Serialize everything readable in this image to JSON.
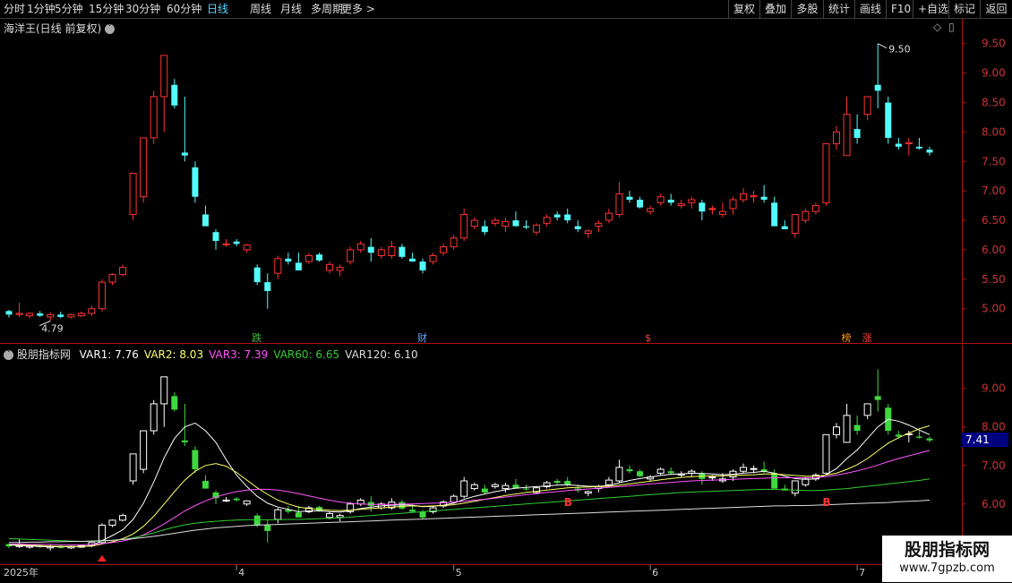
{
  "toolbar": {
    "periods": [
      "分时",
      "1分钟",
      "5分钟",
      "15分钟",
      "30分钟",
      "60分钟",
      "日线",
      "周线",
      "月线",
      "多周期",
      "更多 >"
    ],
    "active_period": "日线",
    "right_buttons": [
      "复权",
      "叠加",
      "多股",
      "统计",
      "画线",
      "F10",
      "+自选",
      "标记",
      "返回"
    ]
  },
  "main": {
    "title": "海洋王(日线 前复权)",
    "high_label": "9.50",
    "low_label": "4.79",
    "y_ticks": [
      "9.50",
      "9.00",
      "8.50",
      "8.00",
      "7.50",
      "7.00",
      "6.50",
      "6.00",
      "5.50",
      "5.00"
    ],
    "event_markers": [
      {
        "text": "跌",
        "color": "#3ec43e"
      },
      {
        "text": "财",
        "color": "#5fa8ff"
      },
      {
        "text": "$",
        "color": "#ff4040"
      },
      {
        "text": "榜",
        "color": "#ff9900"
      },
      {
        "text": "涨",
        "color": "#ff4040"
      }
    ]
  },
  "indicator": {
    "name": "股朋指标网",
    "vars": [
      {
        "label": "VAR1: 7.76",
        "color": "#ffffff"
      },
      {
        "label": "VAR2: 8.03",
        "color": "#ffff66"
      },
      {
        "label": "VAR3: 7.39",
        "color": "#ff55ff"
      },
      {
        "label": "VAR60: 6.65",
        "color": "#33cc33"
      },
      {
        "label": "VAR120: 6.10",
        "color": "#dddddd"
      }
    ],
    "y_ticks": [
      "9.00",
      "8.00",
      "7.00",
      "6.00"
    ],
    "current_price": "7.41",
    "signals": [
      "B",
      "B"
    ]
  },
  "time_axis": {
    "labels": [
      "2025年",
      "4",
      "5",
      "6",
      "7"
    ]
  },
  "watermark": {
    "line1": "股朋指标网",
    "line2": "www.7gpzb.com"
  },
  "colors": {
    "up": "#ff3333",
    "down": "#54fcfc",
    "bg": "#000000",
    "axis": "#b01010",
    "active": "#5fd3ff"
  },
  "chart_data": {
    "type": "candlestick",
    "ylim": [
      4.6,
      9.8
    ],
    "y_ticks": [
      9.5,
      9.0,
      8.5,
      8.0,
      7.5,
      7.0,
      6.5,
      6.0,
      5.5,
      5.0
    ],
    "ohlc": [
      [
        4.96,
        4.98,
        4.85,
        4.9
      ],
      [
        4.9,
        5.1,
        4.86,
        4.92
      ],
      [
        4.88,
        4.94,
        4.84,
        4.92
      ],
      [
        4.92,
        4.96,
        4.86,
        4.88
      ],
      [
        4.86,
        4.94,
        4.79,
        4.9
      ],
      [
        4.9,
        4.95,
        4.84,
        4.86
      ],
      [
        4.86,
        4.92,
        4.83,
        4.9
      ],
      [
        4.88,
        4.95,
        4.86,
        4.92
      ],
      [
        4.92,
        5.05,
        4.88,
        5.0
      ],
      [
        5.0,
        5.5,
        4.95,
        5.45
      ],
      [
        5.45,
        5.6,
        5.4,
        5.58
      ],
      [
        5.58,
        5.75,
        5.55,
        5.7
      ],
      [
        6.6,
        7.3,
        6.5,
        7.3
      ],
      [
        6.9,
        7.9,
        6.8,
        7.9
      ],
      [
        7.9,
        8.7,
        7.8,
        8.6
      ],
      [
        8.6,
        9.3,
        8.0,
        9.3
      ],
      [
        8.8,
        8.9,
        8.4,
        8.45
      ],
      [
        7.65,
        8.6,
        7.5,
        7.6
      ],
      [
        7.4,
        7.5,
        6.8,
        6.9
      ],
      [
        6.6,
        6.75,
        6.4,
        6.4
      ],
      [
        6.3,
        6.35,
        6.0,
        6.15
      ],
      [
        6.1,
        6.18,
        6.05,
        6.1
      ],
      [
        6.14,
        6.18,
        6.06,
        6.1
      ],
      [
        6.0,
        6.1,
        5.95,
        6.08
      ],
      [
        5.7,
        5.75,
        5.4,
        5.45
      ],
      [
        5.45,
        5.6,
        5.0,
        5.3
      ],
      [
        5.6,
        5.9,
        5.5,
        5.85
      ],
      [
        5.85,
        5.95,
        5.75,
        5.8
      ],
      [
        5.78,
        5.95,
        5.7,
        5.65
      ],
      [
        5.8,
        5.95,
        5.76,
        5.9
      ],
      [
        5.92,
        5.95,
        5.8,
        5.82
      ],
      [
        5.65,
        5.8,
        5.6,
        5.75
      ],
      [
        5.65,
        5.75,
        5.55,
        5.7
      ],
      [
        5.8,
        6.05,
        5.75,
        6.0
      ],
      [
        6.0,
        6.15,
        5.95,
        6.1
      ],
      [
        6.05,
        6.2,
        5.8,
        5.95
      ],
      [
        5.9,
        6.05,
        5.85,
        6.0
      ],
      [
        5.9,
        6.15,
        5.85,
        6.05
      ],
      [
        6.05,
        6.1,
        5.85,
        5.88
      ],
      [
        5.85,
        5.95,
        5.8,
        5.8
      ],
      [
        5.8,
        5.85,
        5.6,
        5.65
      ],
      [
        5.8,
        5.95,
        5.75,
        5.9
      ],
      [
        5.95,
        6.1,
        5.9,
        6.05
      ],
      [
        6.05,
        6.25,
        6.0,
        6.2
      ],
      [
        6.2,
        6.7,
        6.15,
        6.6
      ],
      [
        6.4,
        6.55,
        6.35,
        6.5
      ],
      [
        6.4,
        6.5,
        6.25,
        6.3
      ],
      [
        6.45,
        6.55,
        6.4,
        6.5
      ],
      [
        6.4,
        6.55,
        6.3,
        6.48
      ],
      [
        6.5,
        6.65,
        6.45,
        6.4
      ],
      [
        6.4,
        6.5,
        6.35,
        6.38
      ],
      [
        6.3,
        6.45,
        6.25,
        6.42
      ],
      [
        6.45,
        6.6,
        6.4,
        6.55
      ],
      [
        6.6,
        6.65,
        6.5,
        6.55
      ],
      [
        6.6,
        6.7,
        6.45,
        6.5
      ],
      [
        6.4,
        6.5,
        6.3,
        6.35
      ],
      [
        6.28,
        6.35,
        6.2,
        6.32
      ],
      [
        6.4,
        6.5,
        6.3,
        6.45
      ],
      [
        6.5,
        6.7,
        6.45,
        6.62
      ],
      [
        6.6,
        7.15,
        6.55,
        6.95
      ],
      [
        6.9,
        7.0,
        6.8,
        6.85
      ],
      [
        6.85,
        6.9,
        6.7,
        6.72
      ],
      [
        6.65,
        6.75,
        6.6,
        6.7
      ],
      [
        6.8,
        6.95,
        6.75,
        6.9
      ],
      [
        6.85,
        6.95,
        6.75,
        6.8
      ],
      [
        6.75,
        6.85,
        6.7,
        6.78
      ],
      [
        6.8,
        6.9,
        6.7,
        6.85
      ],
      [
        6.8,
        6.85,
        6.5,
        6.65
      ],
      [
        6.7,
        6.75,
        6.6,
        6.7
      ],
      [
        6.6,
        6.8,
        6.55,
        6.65
      ],
      [
        6.7,
        6.9,
        6.6,
        6.85
      ],
      [
        6.85,
        7.05,
        6.8,
        6.95
      ],
      [
        6.9,
        7.0,
        6.8,
        6.92
      ],
      [
        6.9,
        7.1,
        6.8,
        6.85
      ],
      [
        6.8,
        6.9,
        6.4,
        6.4
      ],
      [
        6.4,
        6.5,
        6.35,
        6.35
      ],
      [
        6.28,
        6.6,
        6.2,
        6.6
      ],
      [
        6.5,
        6.7,
        6.45,
        6.65
      ],
      [
        6.65,
        6.8,
        6.6,
        6.75
      ],
      [
        6.8,
        7.8,
        6.75,
        7.8
      ],
      [
        7.8,
        8.1,
        7.7,
        8.0
      ],
      [
        7.6,
        8.6,
        7.6,
        8.3
      ],
      [
        8.05,
        8.3,
        7.8,
        7.9
      ],
      [
        8.3,
        8.6,
        8.2,
        8.6
      ],
      [
        8.8,
        9.5,
        8.4,
        8.7
      ],
      [
        8.5,
        8.6,
        7.8,
        7.9
      ],
      [
        7.8,
        7.9,
        7.7,
        7.75
      ],
      [
        7.8,
        7.9,
        7.6,
        7.82
      ],
      [
        7.75,
        7.9,
        7.7,
        7.72
      ],
      [
        7.7,
        7.75,
        7.6,
        7.65
      ]
    ],
    "series": [
      {
        "name": "VAR1",
        "values": [
          4.94,
          4.92,
          4.91,
          4.9,
          4.89,
          4.89,
          4.89,
          4.9,
          4.92,
          5.05,
          5.18,
          5.33,
          5.6,
          6.02,
          6.57,
          7.2,
          7.7,
          8.0,
          8.1,
          7.9,
          7.6,
          7.15,
          6.75,
          6.45,
          6.2,
          6.02,
          5.92,
          5.86,
          5.8,
          5.82,
          5.82,
          5.8,
          5.79,
          5.83,
          5.88,
          5.92,
          5.95,
          5.97,
          5.98,
          5.97,
          5.93,
          5.94,
          5.97,
          6.02,
          6.12,
          6.2,
          6.26,
          6.32,
          6.37,
          6.41,
          6.43,
          6.45,
          6.47,
          6.49,
          6.5,
          6.48,
          6.46,
          6.46,
          6.48,
          6.55,
          6.61,
          6.66,
          6.7,
          6.74,
          6.77,
          6.78,
          6.8,
          6.79,
          6.78,
          6.76,
          6.77,
          6.8,
          6.82,
          6.85,
          6.8,
          6.72,
          6.66,
          6.64,
          6.65,
          6.76,
          6.92,
          7.18,
          7.4,
          7.7,
          8.0,
          8.2,
          8.15,
          8.05,
          7.92,
          7.8
        ]
      },
      {
        "name": "VAR2",
        "values": [
          4.95,
          4.94,
          4.93,
          4.92,
          4.91,
          4.9,
          4.9,
          4.9,
          4.91,
          4.96,
          5.02,
          5.1,
          5.22,
          5.42,
          5.68,
          6.0,
          6.32,
          6.62,
          6.85,
          7.0,
          7.05,
          6.98,
          6.82,
          6.62,
          6.42,
          6.25,
          6.1,
          6.0,
          5.92,
          5.88,
          5.86,
          5.84,
          5.83,
          5.84,
          5.86,
          5.88,
          5.9,
          5.92,
          5.94,
          5.95,
          5.94,
          5.95,
          5.96,
          5.98,
          6.02,
          6.07,
          6.12,
          6.17,
          6.22,
          6.26,
          6.3,
          6.33,
          6.36,
          6.39,
          6.42,
          6.43,
          6.44,
          6.45,
          6.46,
          6.49,
          6.52,
          6.56,
          6.59,
          6.63,
          6.66,
          6.69,
          6.71,
          6.72,
          6.73,
          6.73,
          6.74,
          6.75,
          6.76,
          6.78,
          6.78,
          6.76,
          6.74,
          6.72,
          6.72,
          6.75,
          6.8,
          6.9,
          7.02,
          7.18,
          7.38,
          7.58,
          7.72,
          7.84,
          7.95,
          8.03
        ]
      },
      {
        "name": "VAR3",
        "values": [
          4.96,
          4.96,
          4.95,
          4.95,
          4.95,
          4.94,
          4.94,
          4.94,
          4.95,
          4.97,
          5.0,
          5.04,
          5.1,
          5.2,
          5.33,
          5.48,
          5.65,
          5.82,
          5.96,
          6.08,
          6.18,
          6.26,
          6.32,
          6.36,
          6.38,
          6.38,
          6.36,
          6.32,
          6.27,
          6.21,
          6.15,
          6.1,
          6.05,
          6.02,
          6.0,
          5.99,
          5.99,
          5.99,
          6.0,
          6.0,
          6.01,
          6.02,
          6.03,
          6.05,
          6.07,
          6.1,
          6.12,
          6.15,
          6.18,
          6.21,
          6.24,
          6.27,
          6.3,
          6.32,
          6.35,
          6.37,
          6.39,
          6.41,
          6.43,
          6.45,
          6.47,
          6.5,
          6.52,
          6.54,
          6.56,
          6.58,
          6.6,
          6.61,
          6.62,
          6.63,
          6.64,
          6.65,
          6.66,
          6.67,
          6.68,
          6.68,
          6.68,
          6.68,
          6.69,
          6.71,
          6.75,
          6.8,
          6.86,
          6.93,
          7.01,
          7.1,
          7.18,
          7.25,
          7.32,
          7.39
        ]
      },
      {
        "name": "VAR60",
        "values": [
          5.1,
          5.09,
          5.08,
          5.07,
          5.06,
          5.05,
          5.04,
          5.03,
          5.03,
          5.04,
          5.06,
          5.08,
          5.12,
          5.18,
          5.25,
          5.33,
          5.4,
          5.46,
          5.5,
          5.53,
          5.55,
          5.57,
          5.58,
          5.59,
          5.59,
          5.59,
          5.59,
          5.6,
          5.6,
          5.61,
          5.62,
          5.63,
          5.64,
          5.66,
          5.68,
          5.7,
          5.72,
          5.74,
          5.76,
          5.78,
          5.8,
          5.82,
          5.84,
          5.86,
          5.88,
          5.9,
          5.92,
          5.94,
          5.96,
          5.98,
          6.0,
          6.02,
          6.04,
          6.06,
          6.08,
          6.1,
          6.12,
          6.14,
          6.16,
          6.18,
          6.2,
          6.22,
          6.24,
          6.26,
          6.28,
          6.3,
          6.31,
          6.32,
          6.33,
          6.34,
          6.35,
          6.36,
          6.37,
          6.38,
          6.38,
          6.37,
          6.36,
          6.35,
          6.35,
          6.36,
          6.38,
          6.4,
          6.43,
          6.46,
          6.49,
          6.52,
          6.55,
          6.58,
          6.61,
          6.65
        ]
      },
      {
        "name": "VAR120",
        "values": [
          5.0,
          5.0,
          5.01,
          5.01,
          5.02,
          5.02,
          5.03,
          5.03,
          5.04,
          5.05,
          5.06,
          5.08,
          5.1,
          5.13,
          5.16,
          5.2,
          5.24,
          5.28,
          5.32,
          5.35,
          5.38,
          5.4,
          5.42,
          5.44,
          5.45,
          5.46,
          5.47,
          5.48,
          5.49,
          5.5,
          5.51,
          5.52,
          5.53,
          5.54,
          5.55,
          5.56,
          5.57,
          5.58,
          5.59,
          5.6,
          5.61,
          5.62,
          5.63,
          5.64,
          5.65,
          5.66,
          5.67,
          5.68,
          5.69,
          5.7,
          5.71,
          5.72,
          5.73,
          5.74,
          5.75,
          5.76,
          5.77,
          5.78,
          5.79,
          5.8,
          5.81,
          5.82,
          5.83,
          5.84,
          5.85,
          5.86,
          5.87,
          5.88,
          5.89,
          5.9,
          5.91,
          5.92,
          5.93,
          5.94,
          5.95,
          5.95,
          5.96,
          5.96,
          5.97,
          5.98,
          5.99,
          6.0,
          6.01,
          6.02,
          6.03,
          6.04,
          6.06,
          6.07,
          6.08,
          6.1
        ]
      }
    ],
    "indicator_ylim": [
      4.6,
      9.9
    ],
    "indicator_y_ticks": [
      9.0,
      8.0,
      7.0,
      6.0
    ]
  }
}
